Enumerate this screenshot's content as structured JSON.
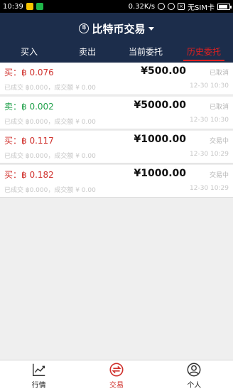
{
  "status_bar": {
    "time": "10:39",
    "speed": "0.32K/s",
    "carrier": "无SIM卡"
  },
  "header": {
    "title": "比特币交易",
    "coin_symbol": "฿"
  },
  "tabs": [
    {
      "label": "买入"
    },
    {
      "label": "卖出"
    },
    {
      "label": "当前委托"
    },
    {
      "label": "历史委托",
      "active": true
    }
  ],
  "orders": [
    {
      "side": "买：฿ 0.076",
      "type": "buy",
      "amount": "¥500.00",
      "status": "已取消",
      "detail": "已成交 ฿0.000，成交额 ¥ 0.00",
      "time": "12-30 10:30"
    },
    {
      "side": "卖：฿ 0.002",
      "type": "sell",
      "amount": "¥5000.00",
      "status": "已取消",
      "detail": "已成交 ฿0.000，成交额 ¥ 0.00",
      "time": "12-30 10:30"
    },
    {
      "side": "买：฿ 0.117",
      "type": "buy",
      "amount": "¥1000.00",
      "status": "交易中",
      "detail": "已成交 ฿0.000，成交额 ¥ 0.00",
      "time": "12-30 10:29"
    },
    {
      "side": "买：฿ 0.182",
      "type": "buy",
      "amount": "¥1000.00",
      "status": "交易中",
      "detail": "已成交 ฿0.000，成交额 ¥ 0.00",
      "time": "12-30 10:29"
    }
  ],
  "bottom_nav": [
    {
      "label": "行情",
      "icon": "chart-icon"
    },
    {
      "label": "交易",
      "icon": "trade-icon",
      "active": true
    },
    {
      "label": "个人",
      "icon": "person-icon"
    }
  ],
  "colors": {
    "header_bg": "#1c2d4b",
    "active_red": "#e02020",
    "buy_red": "#d0312d",
    "sell_green": "#21a14b"
  }
}
